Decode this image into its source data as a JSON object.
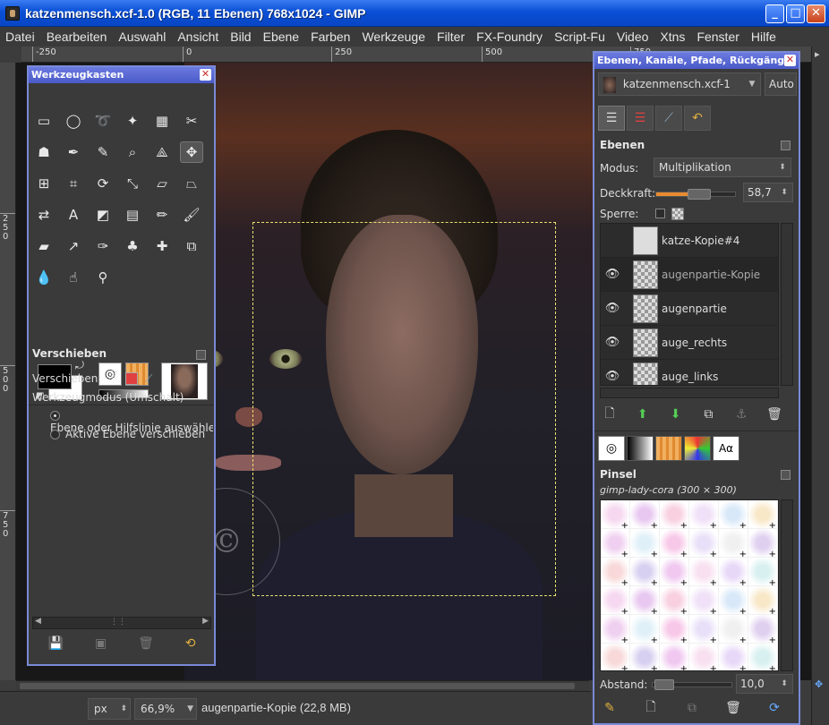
{
  "window": {
    "title": "katzenmensch.xcf-1.0 (RGB, 11 Ebenen) 768x1024 - GIMP",
    "buttons": {
      "minimize": "_",
      "maximize": "□",
      "close": "✕"
    }
  },
  "menubar": [
    "Datei",
    "Bearbeiten",
    "Auswahl",
    "Ansicht",
    "Bild",
    "Ebene",
    "Farben",
    "Werkzeuge",
    "Filter",
    "FX-Foundry",
    "Script-Fu",
    "Video",
    "Xtns",
    "Fenster",
    "Hilfe"
  ],
  "ruler": {
    "horizontal": [
      "-250",
      "0",
      "250",
      "500",
      "750"
    ],
    "vertical": [
      "250",
      "500",
      "750"
    ]
  },
  "canvas": {
    "watermark": "Gimp-Lady Cora",
    "watermark_symbol": "©"
  },
  "statusbar": {
    "unit": "px",
    "zoom": "66,9%",
    "info": "augenpartie-Kopie (22,8 MB)"
  },
  "toolbox": {
    "title": "Werkzeugkasten",
    "tools": [
      {
        "name": "rect-select-icon",
        "glyph": "▭"
      },
      {
        "name": "ellipse-select-icon",
        "glyph": "◯"
      },
      {
        "name": "lasso-icon",
        "glyph": "➰"
      },
      {
        "name": "fuzzy-select-icon",
        "glyph": "✦"
      },
      {
        "name": "color-select-icon",
        "glyph": "▦"
      },
      {
        "name": "scissors-icon",
        "glyph": "✂"
      },
      {
        "name": "foreground-select-icon",
        "glyph": "☗"
      },
      {
        "name": "paths-icon",
        "glyph": "✒"
      },
      {
        "name": "color-picker-icon",
        "glyph": "✎"
      },
      {
        "name": "zoom-icon",
        "glyph": "⌕"
      },
      {
        "name": "measure-icon",
        "glyph": "⟁"
      },
      {
        "name": "move-icon",
        "glyph": "✥"
      },
      {
        "name": "align-icon",
        "glyph": "⊞"
      },
      {
        "name": "crop-icon",
        "glyph": "⌗"
      },
      {
        "name": "rotate-icon",
        "glyph": "⟳"
      },
      {
        "name": "scale-icon",
        "glyph": "⤡"
      },
      {
        "name": "shear-icon",
        "glyph": "▱"
      },
      {
        "name": "perspective-icon",
        "glyph": "⏢"
      },
      {
        "name": "flip-icon",
        "glyph": "⇄"
      },
      {
        "name": "text-icon",
        "glyph": "A"
      },
      {
        "name": "bucket-fill-icon",
        "glyph": "◩"
      },
      {
        "name": "blend-icon",
        "glyph": "▤"
      },
      {
        "name": "pencil-icon",
        "glyph": "✏"
      },
      {
        "name": "paintbrush-icon",
        "glyph": "🖌"
      },
      {
        "name": "eraser-icon",
        "glyph": "▰"
      },
      {
        "name": "airbrush-icon",
        "glyph": "↗"
      },
      {
        "name": "ink-icon",
        "glyph": "✑"
      },
      {
        "name": "clone-icon",
        "glyph": "♣"
      },
      {
        "name": "heal-icon",
        "glyph": "✚"
      },
      {
        "name": "perspective-clone-icon",
        "glyph": "⧉"
      },
      {
        "name": "blur-icon",
        "glyph": "💧"
      },
      {
        "name": "smudge-icon",
        "glyph": "☝"
      },
      {
        "name": "dodge-burn-icon",
        "glyph": "⚲"
      }
    ],
    "options": {
      "heading": "Verschieben",
      "move_label": "Verschieben:",
      "mode_label": "Werkzeugmodus (Umschalt)",
      "radio1": "Ebene oder Hilfslinie auswählen",
      "radio2": "Aktive Ebene verschieben"
    }
  },
  "layers_dock": {
    "title": "Ebenen, Kanäle, Pfade, Rückgängig - …",
    "image_combo": "katzenmensch.xcf-1",
    "auto_button": "Auto",
    "heading": "Ebenen",
    "mode_label": "Modus:",
    "mode_value": "Multiplikation",
    "opacity_label": "Deckkraft:",
    "opacity_value": "58,7",
    "opacity_fraction": 0.587,
    "lock_label": "Sperre:",
    "layers": [
      {
        "name": "katze-Kopie#4",
        "visible": false,
        "selected": false
      },
      {
        "name": "augenpartie-Kopie",
        "visible": true,
        "selected": true
      },
      {
        "name": "augenpartie",
        "visible": true,
        "selected": false
      },
      {
        "name": "auge_rechts",
        "visible": true,
        "selected": false
      },
      {
        "name": "auge_links",
        "visible": true,
        "selected": false
      }
    ]
  },
  "brushes_dock": {
    "heading": "Pinsel",
    "brush_name": "gimp-lady-cora (300 × 300)",
    "spacing_label": "Abstand:",
    "spacing_value": "10,0",
    "tab_text": "Aα"
  }
}
